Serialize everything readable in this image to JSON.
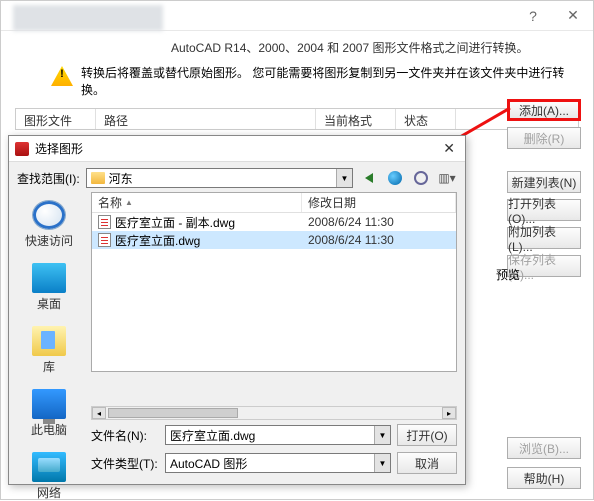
{
  "titlebar": {
    "help": "?",
    "close": "✕"
  },
  "desc_line1": "AutoCAD R14、2000、2004 和 2007 图形文件格式之间进行转换。",
  "desc_line2": "转换后将覆盖或替代原始图形。 您可能需要将图形复制到另一文件夹并在该文件夹中进行转换。",
  "grid": {
    "c1": "图形文件",
    "c2": "路径",
    "c3": "当前格式",
    "c4": "状态"
  },
  "rbtn": {
    "add": "添加(A)...",
    "del": "删除(R)",
    "new": "新建列表(N)",
    "open": "打开列表(O)...",
    "app": "附加列表(L)...",
    "save": "保存列表(S)..."
  },
  "preview": "预览",
  "browse": "浏览(B)...",
  "help": "帮助(H)",
  "dlg": {
    "title": "选择图形",
    "lookin": "查找范围(I):",
    "folder": "河东",
    "cols": {
      "name": "名称",
      "mod": "修改日期"
    },
    "rows": [
      {
        "name": "医疗室立面 - 副本.dwg",
        "date": "2008/6/24 11:30"
      },
      {
        "name": "医疗室立面.dwg",
        "date": "2008/6/24 11:30"
      }
    ],
    "places": {
      "quick": "快速访问",
      "desk": "桌面",
      "lib": "库",
      "pc": "此电脑",
      "net": "网络"
    },
    "fname_l": "文件名(N):",
    "fname_v": "医疗室立面.dwg",
    "ftype_l": "文件类型(T):",
    "ftype_v": "AutoCAD 图形",
    "open": "打开(O)",
    "cancel": "取消"
  }
}
